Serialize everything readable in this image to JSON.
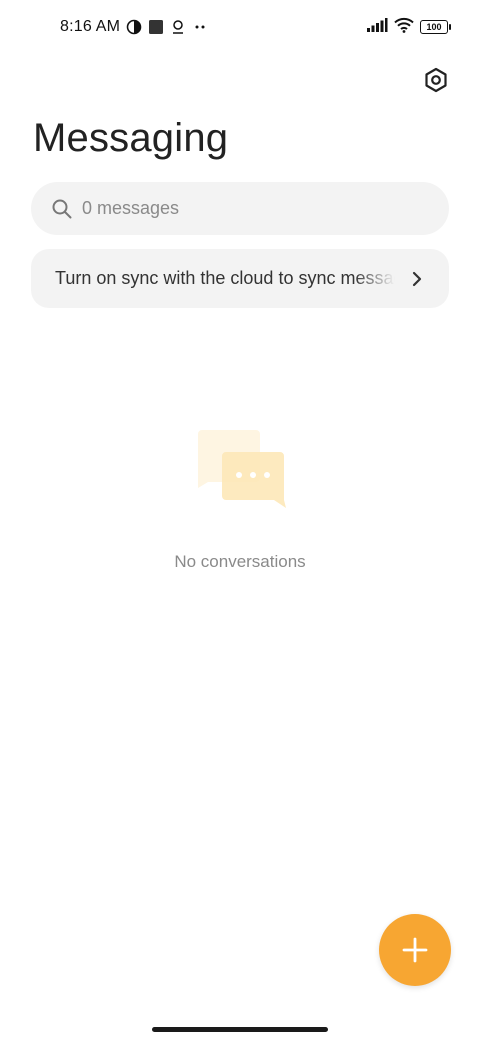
{
  "status_bar": {
    "time": "8:16 AM",
    "left_icons": [
      "data-saver-icon",
      "square-app-icon",
      "sync-person-icon",
      "more-dots-icon"
    ],
    "right_icons": [
      "signal-icon",
      "wifi-icon",
      "battery-icon"
    ],
    "battery": "100"
  },
  "header": {
    "title": "Messaging",
    "settings_icon": "settings-hexagon-icon"
  },
  "search": {
    "placeholder": "0 messages",
    "icon": "search-icon"
  },
  "sync_banner": {
    "text": "Turn on sync with the cloud to sync messages",
    "icon": "chevron-right-icon"
  },
  "empty_state": {
    "icon": "chat-bubbles-icon",
    "text": "No conversations"
  },
  "fab": {
    "icon": "plus-icon",
    "color": "#f7a632"
  },
  "colors": {
    "accent": "#f7a632",
    "illustration": "#fdeec9",
    "card_background": "#f3f3f3"
  }
}
